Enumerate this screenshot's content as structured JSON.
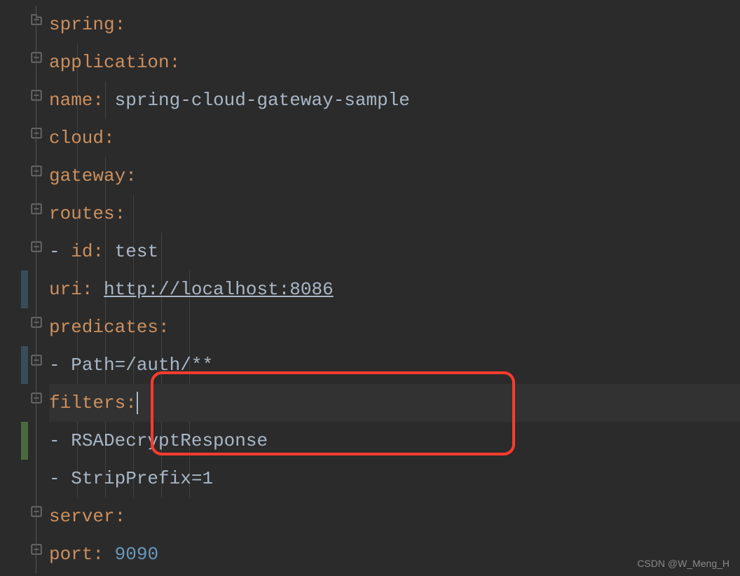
{
  "yaml": {
    "lines": [
      {
        "indent": 0,
        "key": "spring",
        "colon": ":",
        "value": ""
      },
      {
        "indent": 1,
        "key": "application",
        "colon": ":",
        "value": ""
      },
      {
        "indent": 2,
        "key": "name",
        "colon": ": ",
        "value": "spring-cloud-gateway-sample"
      },
      {
        "indent": 1,
        "key": "cloud",
        "colon": ":",
        "value": ""
      },
      {
        "indent": 2,
        "key": "gateway",
        "colon": ":",
        "value": ""
      },
      {
        "indent": 3,
        "key": "routes",
        "colon": ":",
        "value": ""
      },
      {
        "indent": 4,
        "dash": "- ",
        "key": "id",
        "colon": ": ",
        "value": "test"
      },
      {
        "indent": 5,
        "key": "uri",
        "colon": ": ",
        "url": "http://localhost:8086"
      },
      {
        "indent": 5,
        "key": "predicates",
        "colon": ":",
        "value": ""
      },
      {
        "indent": 6,
        "dash": "- ",
        "value": "Path=/auth/**"
      },
      {
        "indent": 5,
        "key": "filters",
        "colon": ":",
        "cursor": true
      },
      {
        "indent": 6,
        "dash": "- ",
        "value": "RSADecryptResponse"
      },
      {
        "indent": 6,
        "dash": "- ",
        "value": "StripPrefix=1"
      },
      {
        "indent": 0,
        "key": "server",
        "colon": ":",
        "value": ""
      },
      {
        "indent": 1,
        "key": "port",
        "colon": ": ",
        "number": "9090"
      }
    ]
  },
  "watermark": "CSDN @W_Meng_H",
  "indentSize": "  "
}
